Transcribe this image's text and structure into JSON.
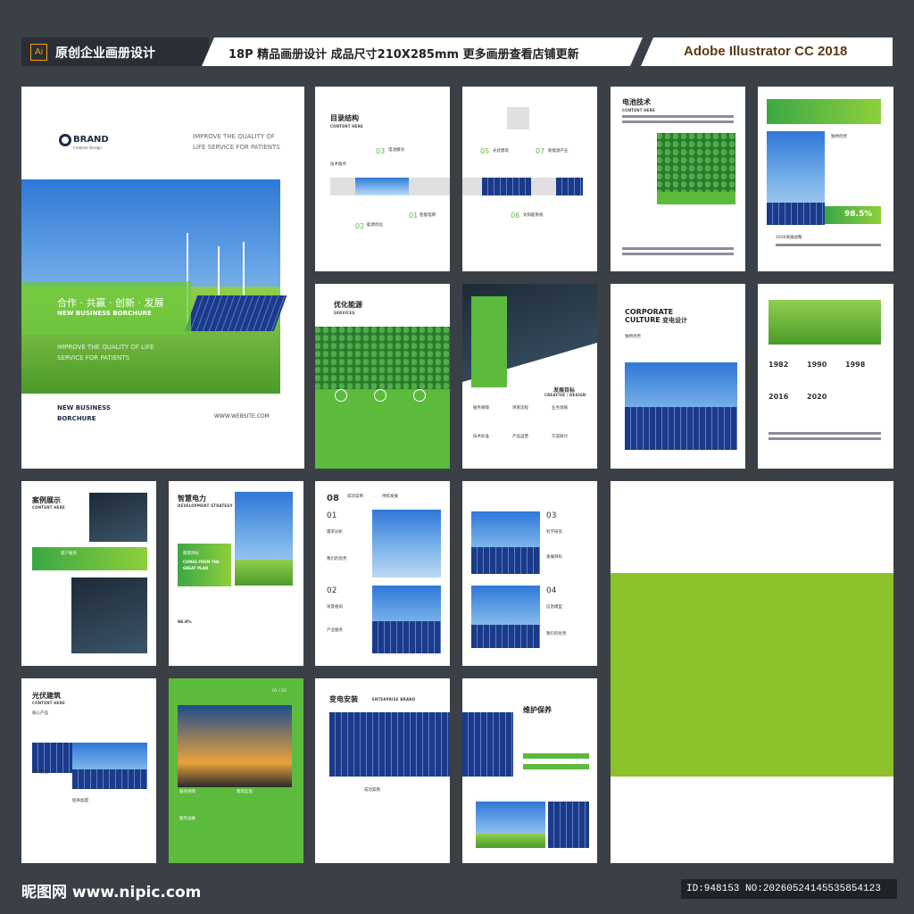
{
  "header": {
    "ai_icon": "Ai",
    "left_title": "原创企业画册设计",
    "middle_title": "18P 精品画册设计 成品尺寸210X285mm 更多画册查看店铺更新",
    "right_title": "Adobe Illustrator CC 2018"
  },
  "cover": {
    "brand": "BRAND",
    "brand_sub": "Creative Design",
    "tagline": "IMPROVE THE QUALITY OF LIFE SERVICE FOR PATIENTS",
    "cn_slogan": "合作 · 共赢 · 创新 · 发展",
    "en_slogan": "NEW BUSINESS BORCHURE",
    "tagline2": "IMPROVE THE QUALITY OF LIFE SERVICE FOR PATIENTS",
    "footer_left": "NEW BUSINESS BORCHURE",
    "website": "WWW.WEBSITE.COM"
  },
  "toc": {
    "title": "目录结构",
    "subtitle": "CONTENT HERE",
    "n03": "03",
    "n01": "01",
    "n02": "02",
    "n05": "05",
    "n07": "07",
    "n06": "06",
    "i_tech": "技术服务",
    "i_battery": "电池模块",
    "i_build": "光伏建筑",
    "i_energy": "能源优化",
    "i_smart": "智能电网",
    "i_new": "新能源产业",
    "i_solar": "太阳能系统"
  },
  "battery": {
    "title": "电池技术",
    "subtitle": "CONTENT HERE"
  },
  "stats": {
    "percent": "98.5%",
    "plan": "2030发展战略",
    "label": "独特优势"
  },
  "services": {
    "title": "优化能源",
    "subtitle": "SERVICES"
  },
  "dev": {
    "title": "发展目标",
    "subtitle": "CREATIVE / DESIGN",
    "i1": "服务保障",
    "i2": "项目流程",
    "i3": "业务领域",
    "i4": "技术标准",
    "i5": "产品运营",
    "i6": "方案研讨"
  },
  "culture": {
    "title_en": "CORPORATE CULTURE",
    "title_cn": "变电设计",
    "label": "独特优势"
  },
  "timeline": {
    "y1": "1982",
    "y2": "1990",
    "y3": "1998",
    "y4": "2016",
    "y5": "2020"
  },
  "cases": {
    "title": "案例展示",
    "subtitle": "CONTENT HERE",
    "band": "客户服务"
  },
  "smart": {
    "title": "智慧电力",
    "subtitle": "DEVELOPMENT STRATEGY",
    "goal": "愿景目标",
    "goal_en": "COMES FROM THE GREAT PLAN",
    "pct": "96.8%"
  },
  "brand_page": {
    "num": "08",
    "title": "成功案例",
    "title2": "持续发展",
    "n01": "01",
    "n02": "02",
    "l1": "需求分析",
    "l2": "我们的优势",
    "l3": "背景格局",
    "l4": "产业服务"
  },
  "science": {
    "n03": "03",
    "n04": "04",
    "l1": "科学研究",
    "l2": "发展目标",
    "l3": "信息模型",
    "l4": "我们的优势"
  },
  "pv": {
    "title": "光伏建筑",
    "subtitle": "CONTENT HERE",
    "core": "核心产品",
    "ai": "人工智能",
    "invest": "招商加盟"
  },
  "power": {
    "num": "01 / 22",
    "i1": "服务保障",
    "i2": "建筑信息",
    "i3": "服务运维"
  },
  "substation": {
    "title": "变电安装",
    "subtitle": "ENTERPRISE BRAND",
    "label": "成功案例"
  },
  "maint": {
    "title": "维护保养"
  },
  "footer": {
    "logo": "昵图网 www.nipic.com",
    "id": "ID:948153 NO:20260524145535854123"
  }
}
